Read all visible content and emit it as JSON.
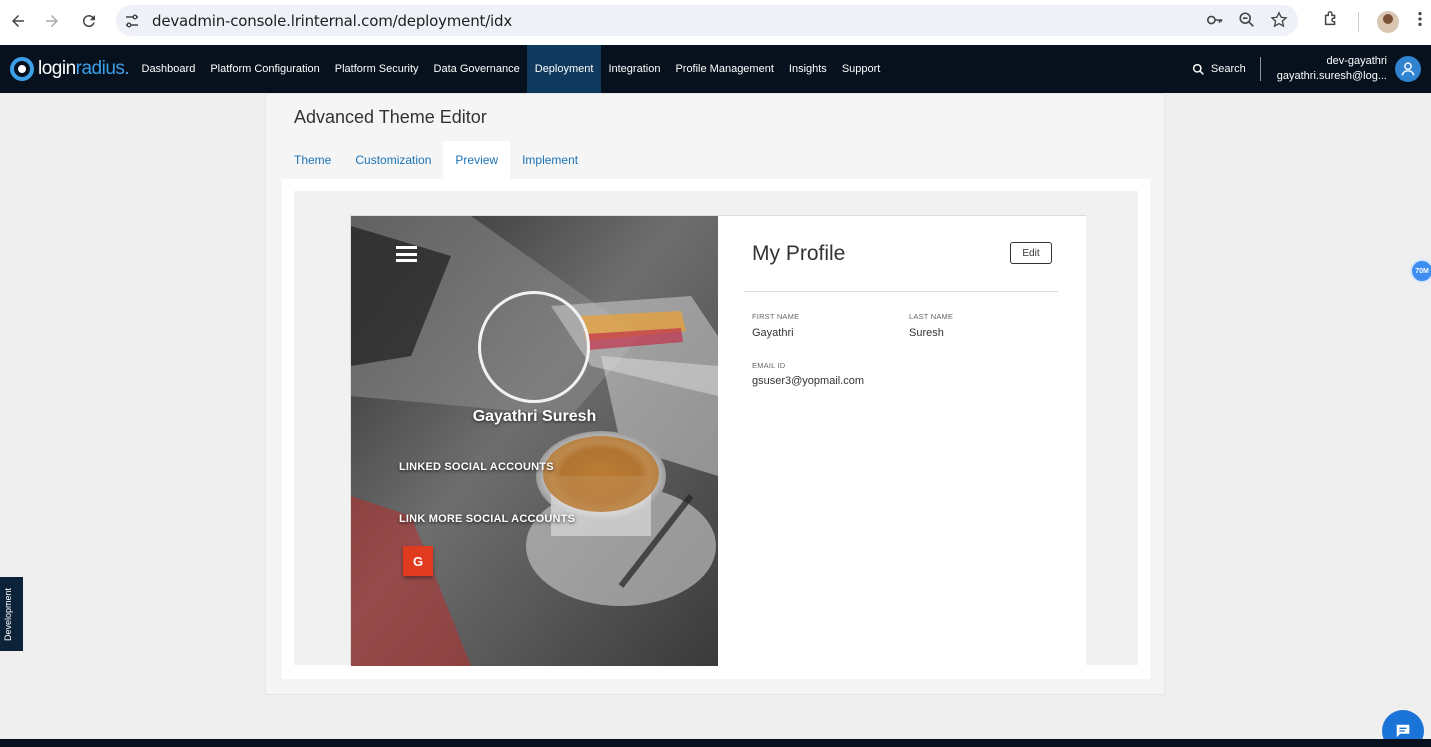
{
  "browser": {
    "url": "devadmin-console.lrinternal.com/deployment/idx"
  },
  "header": {
    "logo_text_a": "login",
    "logo_text_b": "radius.",
    "nav_items": [
      {
        "label": "Dashboard"
      },
      {
        "label": "Platform Configuration"
      },
      {
        "label": "Platform Security"
      },
      {
        "label": "Data Governance"
      },
      {
        "label": "Deployment",
        "active": true
      },
      {
        "label": "Integration"
      },
      {
        "label": "Profile Management"
      },
      {
        "label": "Insights"
      },
      {
        "label": "Support"
      }
    ],
    "search_label": "Search",
    "user_name": "dev-gayathri",
    "user_email": "gayathri.suresh@log..."
  },
  "page": {
    "title": "Advanced Theme Editor",
    "tabs": [
      {
        "label": "Theme"
      },
      {
        "label": "Customization"
      },
      {
        "label": "Preview",
        "active": true
      },
      {
        "label": "Implement"
      }
    ]
  },
  "preview": {
    "profile_name": "Gayathri Suresh",
    "linked_accounts_label": "LINKED SOCIAL ACCOUNTS",
    "link_more_label": "LINK MORE SOCIAL ACCOUNTS",
    "google_letter": "G",
    "heading": "My Profile",
    "edit_label": "Edit",
    "fields": {
      "first_name_label": "FIRST NAME",
      "first_name_value": "Gayathri",
      "last_name_label": "LAST NAME",
      "last_name_value": "Suresh",
      "email_label": "EMAIL ID",
      "email_value": "gsuser3@yopmail.com"
    }
  },
  "misc": {
    "dev_tab_label": "Development",
    "badge_label": "70M"
  },
  "colors": {
    "header_bg": "#07111d",
    "active_nav": "#0f3a5e",
    "link_blue": "#1a73b8",
    "google_red": "#e13b1f"
  }
}
